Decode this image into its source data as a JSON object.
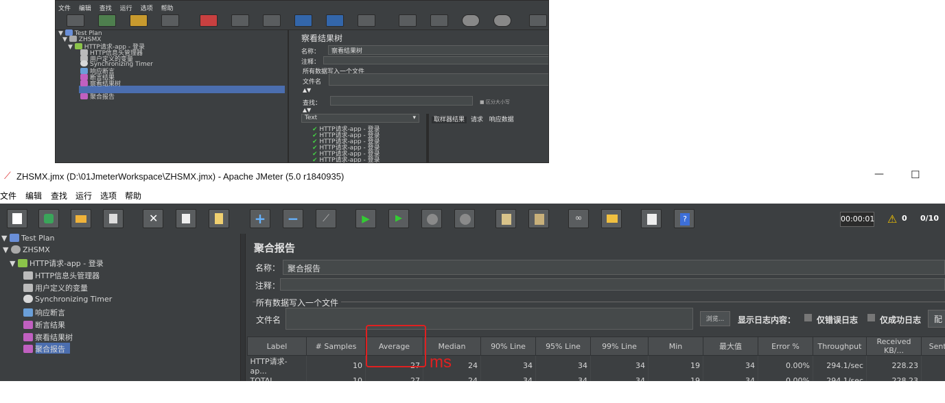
{
  "thumb": {
    "menu": [
      "文件",
      "编辑",
      "查找",
      "运行",
      "选项",
      "帮助"
    ],
    "tree": [
      {
        "label": "Test Plan",
        "icon": "test-plan-icon",
        "depth": 0
      },
      {
        "label": "ZHSMX",
        "icon": "gear-icon",
        "depth": 1
      },
      {
        "label": "HTTP请求-app - 登录",
        "icon": "pen-icon",
        "depth": 2
      },
      {
        "label": "HTTP信息头管理器",
        "icon": "tools-icon",
        "depth": 3
      },
      {
        "label": "用户定义的变量",
        "icon": "tools-icon",
        "depth": 3
      },
      {
        "label": "Synchronizing Timer",
        "icon": "timer-icon",
        "depth": 3
      },
      {
        "label": "响应断言",
        "icon": "assertion-icon",
        "depth": 3
      },
      {
        "label": "断言结果",
        "icon": "chart-icon",
        "depth": 3
      },
      {
        "label": "察看结果树",
        "icon": "chart-icon",
        "depth": 3
      },
      {
        "label": "聚合报告",
        "icon": "chart-icon",
        "depth": 3
      }
    ],
    "panel_title": "察看结果树",
    "name_label": "名称：",
    "name_value": "察看结果树",
    "comment_label": "注释：",
    "section_label": "所有数据写入一个文件",
    "filename_label": "文件名",
    "search_label": "查找：",
    "case_label": "区分大小写",
    "text_dropdown": "Text",
    "tabs": [
      "取样器结果",
      "请求",
      "响应数据"
    ],
    "results": [
      "HTTP请求-app - 登录",
      "HTTP请求-app - 登录",
      "HTTP请求-app - 登录",
      "HTTP请求-app - 登录",
      "HTTP请求-app - 登录",
      "HTTP请求-app - 登录"
    ]
  },
  "window": {
    "title": "ZHSMX.jmx (D:\\01JmeterWorkspace\\ZHSMX.jmx) - Apache JMeter (5.0 r1840935)",
    "minimize": "—",
    "maximize": "☐"
  },
  "menu": [
    "文件",
    "编辑",
    "查找",
    "运行",
    "选项",
    "帮助"
  ],
  "toolbar": {
    "timer": "00:00:01",
    "warning_count": "0",
    "threads": "0/10"
  },
  "tree": [
    {
      "label": "Test Plan",
      "icon": "test-plan-icon",
      "depth": 0
    },
    {
      "label": "ZHSMX",
      "icon": "gear-icon",
      "depth": 1
    },
    {
      "label": "HTTP请求-app - 登录",
      "icon": "pen-icon",
      "depth": 2
    },
    {
      "label": "HTTP信息头管理器",
      "icon": "tools-icon",
      "depth": 3
    },
    {
      "label": "用户定义的变量",
      "icon": "tools-icon",
      "depth": 3
    },
    {
      "label": "Synchronizing Timer",
      "icon": "timer-icon",
      "depth": 3
    },
    {
      "label": "响应断言",
      "icon": "assertion-icon",
      "depth": 3
    },
    {
      "label": "断言结果",
      "icon": "chart-icon",
      "depth": 3
    },
    {
      "label": "察看结果树",
      "icon": "chart-icon",
      "depth": 3
    },
    {
      "label": "聚合报告",
      "icon": "chart-icon",
      "depth": 3
    }
  ],
  "panel": {
    "title": "聚合报告",
    "name_label": "名称：",
    "name_value": "聚合报告",
    "comment_label": "注释：",
    "section_label": "所有数据写入一个文件",
    "filename_label": "文件名",
    "browse_button": "浏览...",
    "log_label": "显示日志内容：",
    "errors_only": "仅错误日志",
    "success_only": "仅成功日志",
    "configure_button": "配"
  },
  "table": {
    "headers": [
      "Label",
      "# Samples",
      "Average",
      "Median",
      "90% Line",
      "95% Line",
      "99% Line",
      "Min",
      "最大值",
      "Error %",
      "Throughput",
      "Received KB/...",
      "Sent K"
    ],
    "rows": [
      [
        "HTTP请求-ap...",
        "10",
        "27",
        "24",
        "34",
        "34",
        "34",
        "19",
        "34",
        "0.00%",
        "294.1/sec",
        "228.23",
        ""
      ],
      [
        "TOTAL",
        "10",
        "27",
        "24",
        "34",
        "34",
        "34",
        "19",
        "34",
        "0.00%",
        "294.1/sec",
        "228.23",
        ""
      ]
    ]
  },
  "annotation": {
    "unit": "ms",
    "color": "#e02020"
  },
  "colors": {
    "background": "#3c3f41",
    "selection": "#4b6eaf",
    "run": "#33cc33",
    "add": "#3399ff"
  }
}
